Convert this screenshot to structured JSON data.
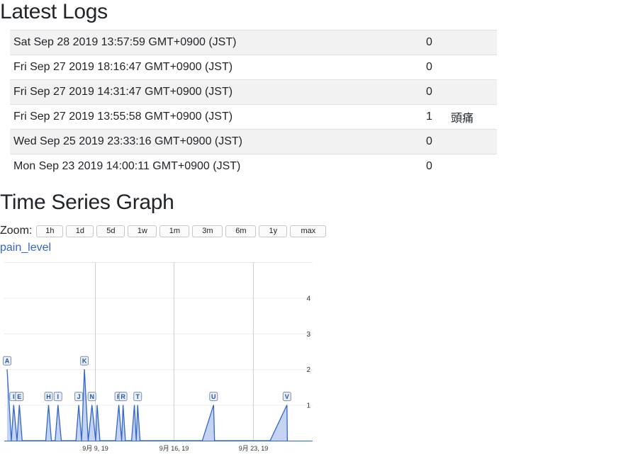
{
  "logs_section": {
    "title": "Latest Logs"
  },
  "logs": [
    {
      "date": "Sat Sep 28 2019 13:57:59 GMT+0900 (JST)",
      "level": "0",
      "note": ""
    },
    {
      "date": "Fri Sep 27 2019 18:16:47 GMT+0900 (JST)",
      "level": "0",
      "note": ""
    },
    {
      "date": "Fri Sep 27 2019 14:31:47 GMT+0900 (JST)",
      "level": "0",
      "note": ""
    },
    {
      "date": "Fri Sep 27 2019 13:55:58 GMT+0900 (JST)",
      "level": "1",
      "note": "頭痛"
    },
    {
      "date": "Wed Sep 25 2019 23:33:16 GMT+0900 (JST)",
      "level": "0",
      "note": ""
    },
    {
      "date": "Mon Sep 23 2019 14:00:11 GMT+0900 (JST)",
      "level": "0",
      "note": ""
    }
  ],
  "graph_section": {
    "title": "Time Series Graph",
    "zoom_label": "Zoom:",
    "zoom_buttons": [
      "1h",
      "1d",
      "5d",
      "1w",
      "1m",
      "3m",
      "6m",
      "1y",
      "max"
    ],
    "legend_label": "pain_level"
  },
  "colors": {
    "series": "#3366cc",
    "fill": "#b9cbee",
    "link": "#3366cc"
  },
  "chart_data": {
    "type": "area",
    "series": [
      {
        "name": "pain_level"
      }
    ],
    "x_domain": [
      "2019-09-01",
      "2019-09-28"
    ],
    "ylim": [
      0,
      5
    ],
    "y_ticks": [
      "1",
      "2",
      "3",
      "4"
    ],
    "x_ticks": [
      {
        "date": "2019-09-09",
        "label": "9月 9, 19"
      },
      {
        "date": "2019-09-16",
        "label": "9月 16, 19"
      },
      {
        "date": "2019-09-23",
        "label": "9月 23, 19"
      }
    ],
    "grid": true,
    "points": [
      {
        "date": "2019-09-01T06:00",
        "value": 2
      },
      {
        "date": "2019-09-01T15:00",
        "value": 0
      },
      {
        "date": "2019-09-01T20:00",
        "value": 1
      },
      {
        "date": "2019-09-02T03:00",
        "value": 0
      },
      {
        "date": "2019-09-02T08:00",
        "value": 1
      },
      {
        "date": "2019-09-02T14:00",
        "value": 0
      },
      {
        "date": "2019-09-04T16:00",
        "value": 0
      },
      {
        "date": "2019-09-04T22:00",
        "value": 1
      },
      {
        "date": "2019-09-05T04:00",
        "value": 0
      },
      {
        "date": "2019-09-05T12:00",
        "value": 0
      },
      {
        "date": "2019-09-05T18:00",
        "value": 1
      },
      {
        "date": "2019-09-06T01:00",
        "value": 0
      },
      {
        "date": "2019-09-07T08:00",
        "value": 0
      },
      {
        "date": "2019-09-07T14:00",
        "value": 1
      },
      {
        "date": "2019-09-07T20:00",
        "value": 0
      },
      {
        "date": "2019-09-08T02:00",
        "value": 2
      },
      {
        "date": "2019-09-08T10:00",
        "value": 0
      },
      {
        "date": "2019-09-08T18:00",
        "value": 1
      },
      {
        "date": "2019-09-09T02:00",
        "value": 0
      },
      {
        "date": "2019-09-09T05:00",
        "value": 1
      },
      {
        "date": "2019-09-09T11:00",
        "value": 0
      },
      {
        "date": "2019-09-10T20:00",
        "value": 0
      },
      {
        "date": "2019-09-11T03:00",
        "value": 1
      },
      {
        "date": "2019-09-11T09:00",
        "value": 0
      },
      {
        "date": "2019-09-11T12:00",
        "value": 1
      },
      {
        "date": "2019-09-11T17:00",
        "value": 0
      },
      {
        "date": "2019-09-12T06:00",
        "value": 0
      },
      {
        "date": "2019-09-12T12:00",
        "value": 1
      },
      {
        "date": "2019-09-12T16:00",
        "value": 0
      },
      {
        "date": "2019-09-12T19:00",
        "value": 1
      },
      {
        "date": "2019-09-13T00:00",
        "value": 0
      },
      {
        "date": "2019-09-18T12:00",
        "value": 0
      },
      {
        "date": "2019-09-19T12:00",
        "value": 1
      },
      {
        "date": "2019-09-19T14:00",
        "value": 0
      },
      {
        "date": "2019-09-24T12:00",
        "value": 0
      },
      {
        "date": "2019-09-25T23:33",
        "value": 1
      },
      {
        "date": "2019-09-26T00:30",
        "value": 0
      }
    ],
    "annotations": [
      {
        "label": "A",
        "date": "2019-09-01T06:00",
        "value": 2
      },
      {
        "label": "I",
        "date": "2019-09-01T20:00",
        "value": 1
      },
      {
        "label": "E",
        "date": "2019-09-02T08:00",
        "value": 1
      },
      {
        "label": "H",
        "date": "2019-09-04T22:00",
        "value": 1
      },
      {
        "label": "I",
        "date": "2019-09-05T18:00",
        "value": 1
      },
      {
        "label": "J",
        "date": "2019-09-07T14:00",
        "value": 1
      },
      {
        "label": "K",
        "date": "2019-09-08T02:00",
        "value": 2
      },
      {
        "label": "N",
        "date": "2019-09-08T18:00",
        "value": 1
      },
      {
        "label": "F",
        "date": "2019-09-11T03:00",
        "value": 1
      },
      {
        "label": "R",
        "date": "2019-09-11T12:00",
        "value": 1
      },
      {
        "label": "T",
        "date": "2019-09-12T19:00",
        "value": 1
      },
      {
        "label": "U",
        "date": "2019-09-19T12:00",
        "value": 1
      },
      {
        "label": "V",
        "date": "2019-09-25T23:33",
        "value": 1
      }
    ]
  }
}
